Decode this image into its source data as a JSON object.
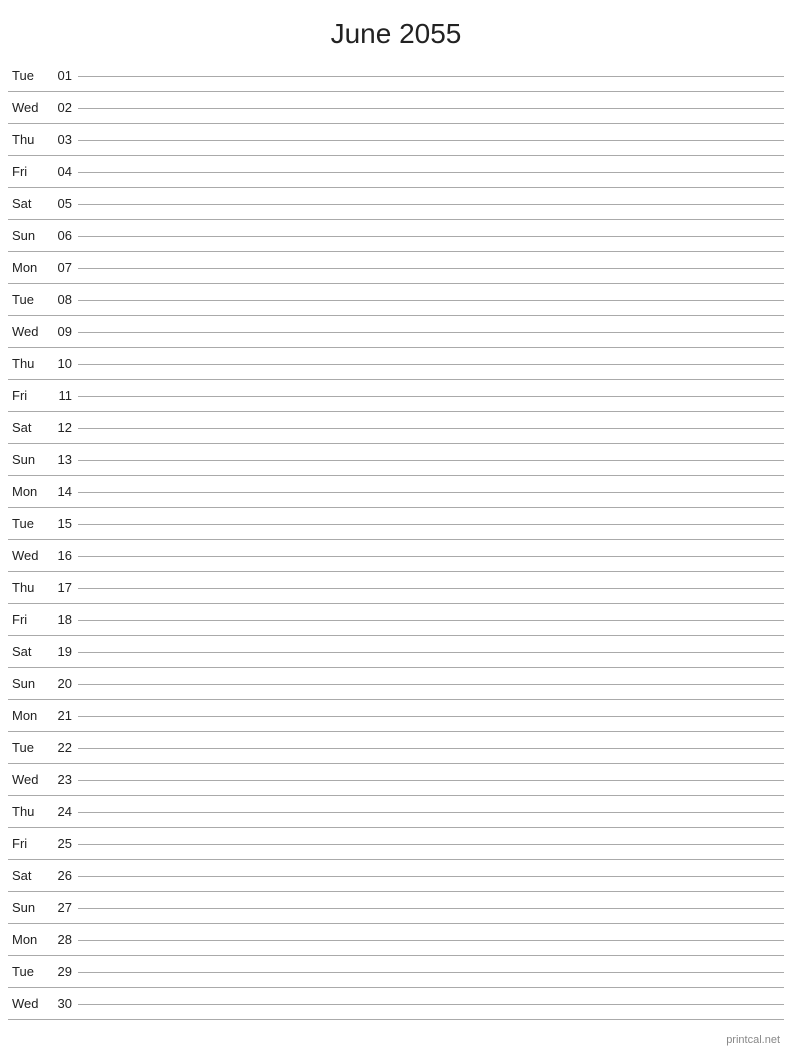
{
  "page": {
    "title": "June 2055",
    "watermark": "printcal.net"
  },
  "days": [
    {
      "name": "Tue",
      "number": "01"
    },
    {
      "name": "Wed",
      "number": "02"
    },
    {
      "name": "Thu",
      "number": "03"
    },
    {
      "name": "Fri",
      "number": "04"
    },
    {
      "name": "Sat",
      "number": "05"
    },
    {
      "name": "Sun",
      "number": "06"
    },
    {
      "name": "Mon",
      "number": "07"
    },
    {
      "name": "Tue",
      "number": "08"
    },
    {
      "name": "Wed",
      "number": "09"
    },
    {
      "name": "Thu",
      "number": "10"
    },
    {
      "name": "Fri",
      "number": "11"
    },
    {
      "name": "Sat",
      "number": "12"
    },
    {
      "name": "Sun",
      "number": "13"
    },
    {
      "name": "Mon",
      "number": "14"
    },
    {
      "name": "Tue",
      "number": "15"
    },
    {
      "name": "Wed",
      "number": "16"
    },
    {
      "name": "Thu",
      "number": "17"
    },
    {
      "name": "Fri",
      "number": "18"
    },
    {
      "name": "Sat",
      "number": "19"
    },
    {
      "name": "Sun",
      "number": "20"
    },
    {
      "name": "Mon",
      "number": "21"
    },
    {
      "name": "Tue",
      "number": "22"
    },
    {
      "name": "Wed",
      "number": "23"
    },
    {
      "name": "Thu",
      "number": "24"
    },
    {
      "name": "Fri",
      "number": "25"
    },
    {
      "name": "Sat",
      "number": "26"
    },
    {
      "name": "Sun",
      "number": "27"
    },
    {
      "name": "Mon",
      "number": "28"
    },
    {
      "name": "Tue",
      "number": "29"
    },
    {
      "name": "Wed",
      "number": "30"
    }
  ]
}
